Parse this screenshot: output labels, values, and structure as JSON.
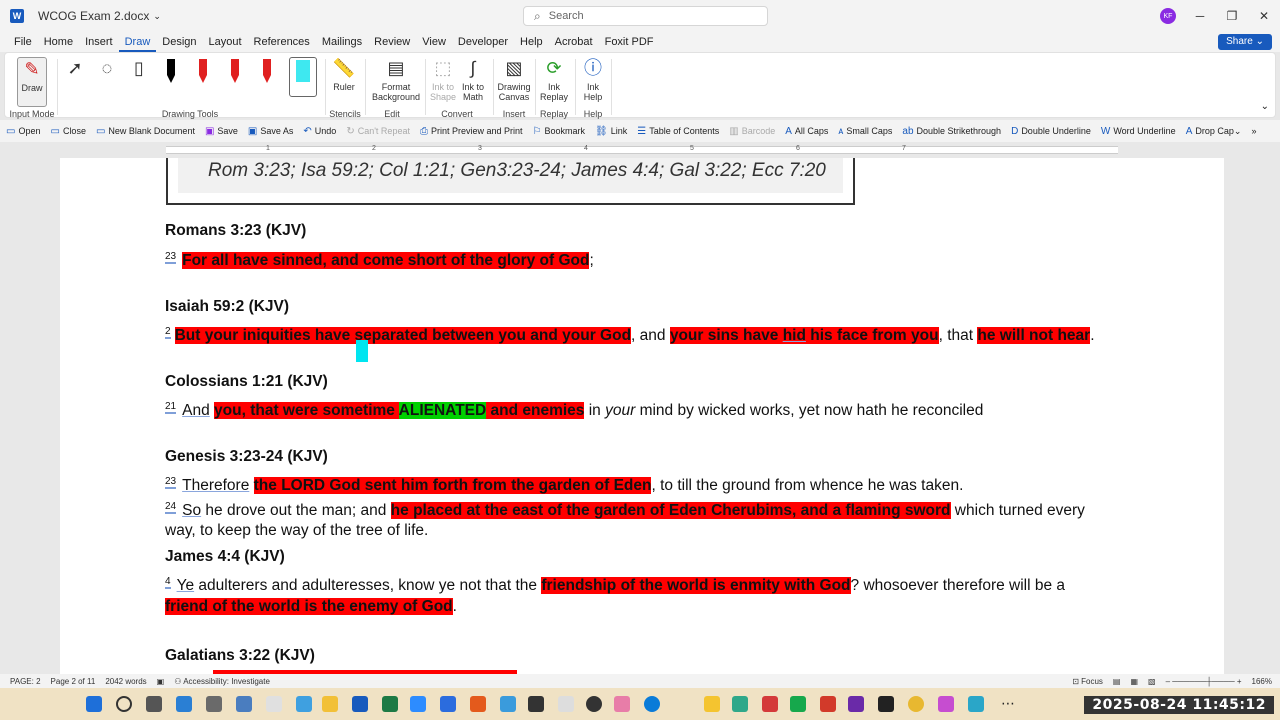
{
  "window": {
    "title": "WCOG Exam 2.docx",
    "search_placeholder": "Search",
    "user_initials": "KF"
  },
  "menu": {
    "tabs": [
      "File",
      "Home",
      "Insert",
      "Draw",
      "Design",
      "Layout",
      "References",
      "Mailings",
      "Review",
      "View",
      "Developer",
      "Help",
      "Acrobat",
      "Foxit PDF"
    ],
    "active": "Draw",
    "share": "Share"
  },
  "ribbon": {
    "draw_label": "Draw",
    "input_mode_label": "Input Mode",
    "drawing_tools_label": "Drawing Tools",
    "ruler_label": "Ruler",
    "stencils_label": "Stencils",
    "format_bg_label1": "Format",
    "format_bg_label2": "Background",
    "edit_label": "Edit",
    "ink_shape1": "Ink to",
    "ink_shape2": "Shape",
    "ink_math1": "Ink to",
    "ink_math2": "Math",
    "convert_label": "Convert",
    "drawing_canvas1": "Drawing",
    "drawing_canvas2": "Canvas",
    "insert_label": "Insert",
    "ink_replay1": "Ink",
    "ink_replay2": "Replay",
    "replay_label": "Replay",
    "ink_help1": "Ink",
    "ink_help2": "Help",
    "help_label": "Help",
    "pen_colors": [
      "#000000",
      "#000000",
      "#e02020",
      "#e02020",
      "#e02020",
      "#3ee8f0"
    ]
  },
  "qat": {
    "open": "Open",
    "close": "Close",
    "new_blank": "New Blank Document",
    "save": "Save",
    "save_as": "Save As",
    "undo": "Undo",
    "cant_repeat": "Can't Repeat",
    "print_preview": "Print Preview and Print",
    "bookmark": "Bookmark",
    "link": "Link",
    "toc": "Table of Contents",
    "barcode": "Barcode",
    "all_caps": "All Caps",
    "small_caps": "Small Caps",
    "double_strike": "Double Strikethrough",
    "double_underline": "Double Underline",
    "word_underline": "Word Underline",
    "drop_cap": "Drop Cap"
  },
  "ruler_numbers": [
    "1",
    "2",
    "3",
    "4",
    "5",
    "6",
    "7"
  ],
  "document": {
    "refbox": "Rom 3:23; Isa 59:2; Col 1:21; Gen3:23-24; James 4:4; Gal 3:22; Ecc 7:20",
    "rom_h": "Romans 3:23 (KJV)",
    "rom_n": "23",
    "rom_r": "For all have sinned, and come short of the glory of God",
    "rom_t": ";",
    "isa_h": "Isaiah 59:2 (KJV)",
    "isa_n": "2",
    "isa_r1": "But your iniquities have separated between you and your God",
    "isa_t1": ", and ",
    "isa_r2a": "your sins have ",
    "isa_r2b": "hid",
    "isa_r2c": " his face from you",
    "isa_t2": ", that ",
    "isa_r3": "he will not hear",
    "isa_t3": ".",
    "col_h": "Colossians 1:21 (KJV)",
    "col_n": "21",
    "col_and": "And",
    "col_r1": "you, that were sometime ",
    "col_g": "ALIENATED",
    "col_r2": " and enemies",
    "col_t1": " in ",
    "col_em": "your",
    "col_t2": " mind by wicked works, yet now hath he reconciled",
    "gen_h": "Genesis 3:23-24 (KJV)",
    "gen_n1": "23",
    "gen_w1": "Therefore",
    "gen_r1": "the LORD God sent him forth from the garden of Eden",
    "gen_t1": ", to till the ground from whence he was taken.",
    "gen_n2": "24",
    "gen_w2": "So",
    "gen_t2": " he drove out the man; and ",
    "gen_r2": "he placed at the east of the garden of Eden Cherubims, and a flaming sword",
    "gen_t3": " which turned every",
    "gen_t4": "way, to keep the way of the tree of life.",
    "jam_h": "James 4:4 (KJV)",
    "jam_n": "4",
    "jam_w": "Ye",
    "jam_t1": " adulterers and adulteresses, know ye not that the ",
    "jam_r1": "friendship of the world is enmity with God",
    "jam_t2": "? whosoever therefore will be a",
    "jam_r2": "friend of the world is the enemy of God",
    "jam_t3": ".",
    "gal_h": "Galatians 3:22 (KJV)"
  },
  "status": {
    "page": "PAGE: 2",
    "page_of": "Page 2 of 11",
    "words": "2042 words",
    "accessibility": "Accessibility: Investigate",
    "focus": "Focus",
    "zoom": "166%"
  },
  "taskbar": {
    "clock": "2025-08-24 11:45:12"
  }
}
